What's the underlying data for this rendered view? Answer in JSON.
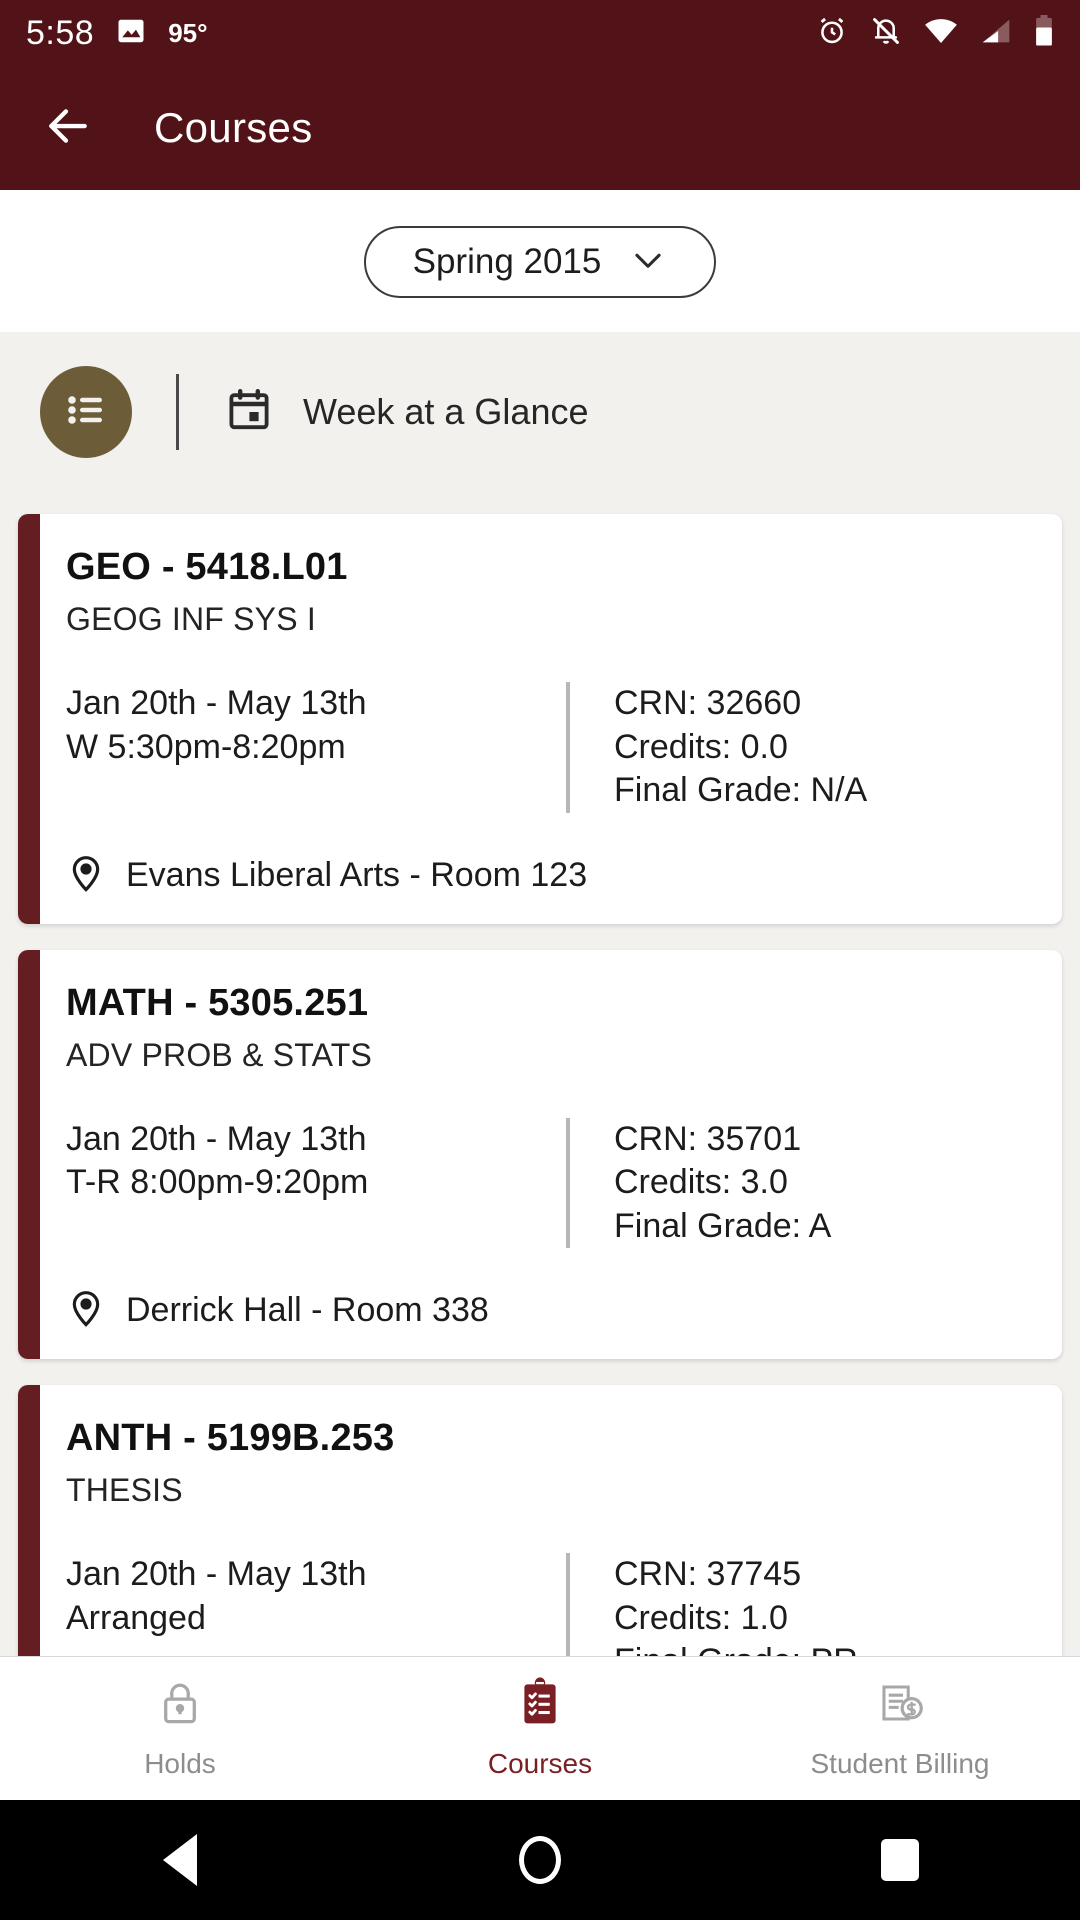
{
  "status_bar": {
    "time": "5:58",
    "temperature": "95°",
    "icons": [
      "image-icon",
      "alarm-icon",
      "notifications-off-icon",
      "wifi-icon",
      "cellular-signal-icon",
      "battery-icon"
    ]
  },
  "app_bar": {
    "title": "Courses",
    "back_icon": "back-arrow-icon"
  },
  "term_selector": {
    "label": "Spring 2015",
    "chevron_icon": "chevron-down-icon"
  },
  "toolbar": {
    "list_button_icon": "list-icon",
    "calendar_icon": "calendar-icon",
    "week_at_a_glance_label": "Week at a Glance"
  },
  "courses": [
    {
      "code": "GEO - 5418.L01",
      "title": "GEOG INF SYS I",
      "dates": "Jan 20th - May 13th",
      "schedule": "W 5:30pm-8:20pm",
      "crn": "CRN: 32660",
      "credits": "Credits: 0.0",
      "final_grade": "Final Grade: N/A",
      "location": "Evans Liberal Arts - Room 123",
      "location_icon": "location-pin-icon"
    },
    {
      "code": "MATH - 5305.251",
      "title": "ADV PROB & STATS",
      "dates": "Jan 20th - May 13th",
      "schedule": "T-R 8:00pm-9:20pm",
      "crn": "CRN: 35701",
      "credits": "Credits: 3.0",
      "final_grade": "Final Grade: A",
      "location": "Derrick Hall - Room 338",
      "location_icon": "location-pin-icon"
    },
    {
      "code": "ANTH - 5199B.253",
      "title": "THESIS",
      "dates": "Jan 20th - May 13th",
      "schedule": "Arranged",
      "crn": "CRN: 37745",
      "credits": "Credits: 1.0",
      "final_grade": "Final Grade: PR",
      "location": "",
      "location_icon": "location-off-icon"
    }
  ],
  "bottom_nav": [
    {
      "label": "Holds",
      "icon": "lock-icon",
      "active": false
    },
    {
      "label": "Courses",
      "icon": "clipboard-checklist-icon",
      "active": true
    },
    {
      "label": "Student Billing",
      "icon": "billing-document-icon",
      "active": false
    }
  ],
  "android_nav": {
    "back": "android-back-icon",
    "home": "android-home-icon",
    "recents": "android-recents-icon"
  },
  "colors": {
    "header_maroon": "#511317",
    "card_accent": "#641e22",
    "accent_active": "#7a1f23",
    "page_background": "#f2f1ee",
    "list_button": "#6d5c38"
  }
}
